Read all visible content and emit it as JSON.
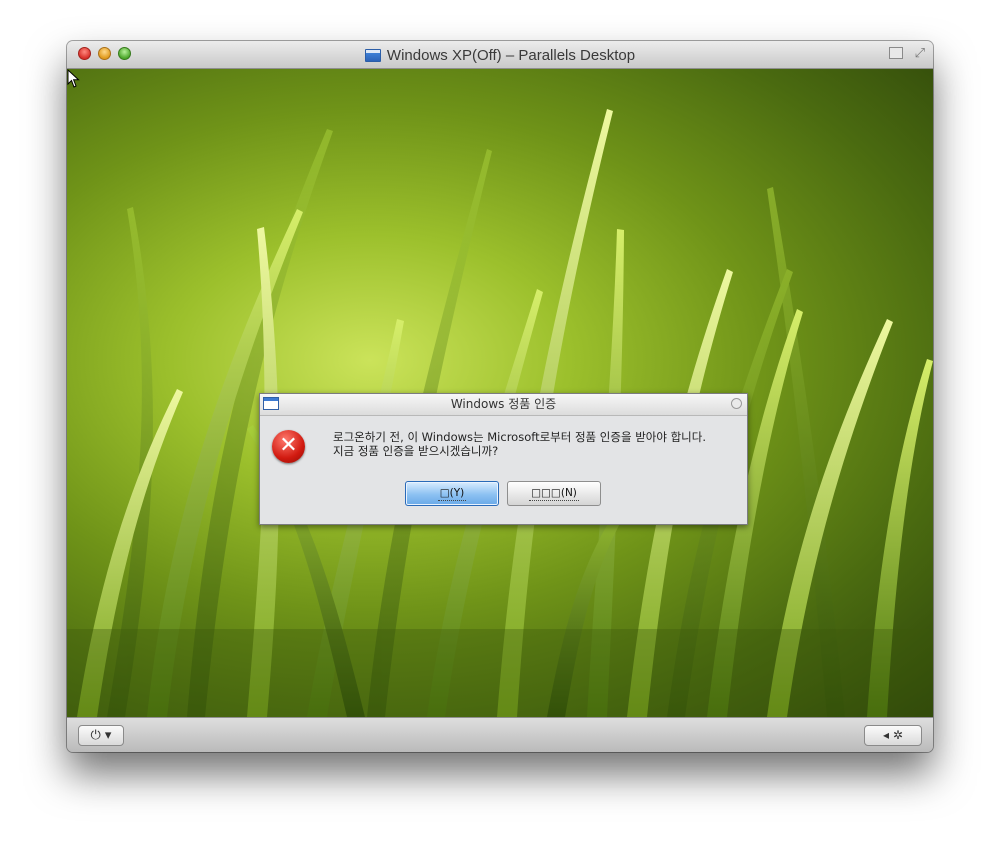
{
  "window": {
    "title": "Windows XP(Off) – Parallels Desktop",
    "buttons": [
      "close",
      "minimize",
      "zoom"
    ],
    "right_icons": [
      "coherence-icon",
      "fullscreen-icon"
    ]
  },
  "dialog": {
    "title": "Windows 정품 인증",
    "message_line1": "로그온하기 전, 이 Windows는 Microsoft로부터 정품 인증을 받아야 합니다.",
    "message_line2": "지금 정품 인증을 받으시겠습니까?",
    "icon": "error-icon",
    "yes_label": "□(Y)",
    "no_label": "□□□(N)"
  },
  "toolbar": {
    "power_label": "⏻ ▾",
    "settings_label": "◂ ✲",
    "power_icon": "power-icon",
    "settings_icon": "gear-icon"
  },
  "colors": {
    "desktop_green": "#8ab22a",
    "dialog_bg": "#e3e4e6",
    "error_red": "#d11a10"
  }
}
